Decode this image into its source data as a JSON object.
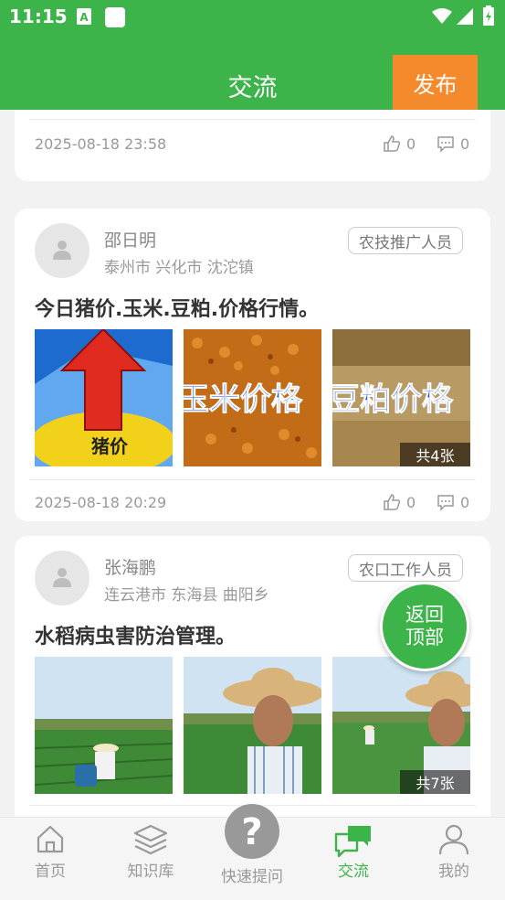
{
  "status_bar": {
    "time": "11:15"
  },
  "header": {
    "title": "交流",
    "publish_label": "发布"
  },
  "posts": [
    {
      "date": "2025-08-18 23:58",
      "likes": "0",
      "comments": "0"
    },
    {
      "author": "邵日明",
      "location": "泰州市 兴化市 沈沱镇",
      "role": "农技推广人员",
      "title": "今日猪价.玉米.豆粕.价格行情。",
      "image_captions": [
        "猪价",
        "玉米价格",
        "豆粕价格"
      ],
      "image_count": "共4张",
      "date": "2025-08-18 20:29",
      "likes": "0",
      "comments": "0"
    },
    {
      "author": "张海鹏",
      "location": "连云港市 东海县 曲阳乡",
      "role": "农口工作人员",
      "title": "水稻病虫害防治管理。",
      "image_count": "共7张"
    }
  ],
  "back_to_top": {
    "line1": "返回",
    "line2": "顶部"
  },
  "bottom_nav": {
    "home": "首页",
    "knowledge": "知识库",
    "ask": "快速提问",
    "exchange": "交流",
    "mine": "我的"
  },
  "colors": {
    "brand_green": "#3cb44a",
    "publish_orange": "#f58a2d"
  },
  "icons": [
    "wifi-icon",
    "signal-icon",
    "battery-icon",
    "like-icon",
    "comment-icon",
    "home-icon",
    "layers-icon",
    "question-icon",
    "chat-icon",
    "user-icon"
  ]
}
